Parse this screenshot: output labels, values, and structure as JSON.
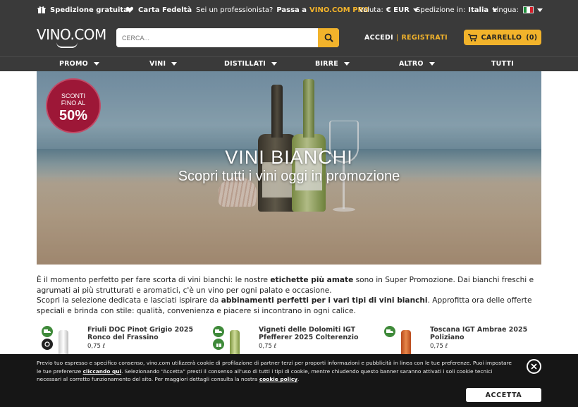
{
  "topbar": {
    "free_shipping": "Spedizione gratuita",
    "loyalty_card": "Carta Fedeltà",
    "pro_question": "Sei un professionista?",
    "pro_link_prefix": "Passa a",
    "pro_link": "VINO.COM PRO",
    "currency_label": "Valuta:",
    "currency_value": "€ EUR",
    "shipping_label": "Spedizione in:",
    "shipping_value": "Italia",
    "language_label": "Lingua:"
  },
  "header": {
    "logo": "VINO.COM",
    "search_placeholder": "CERCA...",
    "login": "ACCEDI",
    "register": "REGISTRATI",
    "cart_label": "CARRELLO",
    "cart_count": "(0)"
  },
  "nav": {
    "items": [
      {
        "label": "PROMO"
      },
      {
        "label": "VINI"
      },
      {
        "label": "DISTILLATI"
      },
      {
        "label": "BIRRE"
      },
      {
        "label": "ALTRO"
      },
      {
        "label": "TUTTI"
      }
    ]
  },
  "hero": {
    "badge_line1": "SCONTI",
    "badge_line2": "FINO AL",
    "badge_value": "50%",
    "title": "VINI BIANCHI",
    "subtitle": "Scopri tutti i vini oggi in promozione"
  },
  "description": {
    "p1_a": "È il momento perfetto per fare scorta di vini bianchi: le nostre ",
    "p1_b": "etichette più amate",
    "p1_c": " sono in Super Promozione. Dai bianchi freschi e agrumati ai più strutturati e aromatici, c'è un vino per ogni palato e occasione.",
    "p2_a": "Scopri la selezione dedicata e lasciati ispirare da ",
    "p2_b": "abbinamenti perfetti per i vari tipi di vini bianchi",
    "p2_c": ". Approfitta ora delle offerte speciali e brinda con stile: qualità, convenienza e piacere si incontrano in ogni calice."
  },
  "products": [
    {
      "name": "Friuli DOC Pinot Grigio 2025 Ronco del Frassino",
      "price": "0,75 ℓ"
    },
    {
      "name": "Vigneti delle Dolomiti IGT Pfefferer 2025 Colterenzio",
      "price": "0,75 ℓ"
    },
    {
      "name": "Toscana IGT Ambrae 2025 Poliziano",
      "price": "0,75 ℓ"
    }
  ],
  "cookie": {
    "t1": "Previo tuo espresso e specifico consenso, vino.com utilizzerà cookie di profilazione di partner terzi per proporti informazioni e pubblicità in linea con le tue preferenze. Puoi impostare le tue preferenze ",
    "link1": "cliccando qui",
    "t2": ". Selezionando “Accetta” presti il consenso all'uso di tutti i tipi di cookie, mentre chiudendo questo banner saranno attivati i soli cookie tecnici necessari al corretto funzionamento del sito. Per maggiori dettagli consulta la nostra ",
    "link2": "cookie policy",
    "t3": ".",
    "accept": "ACCETTA"
  },
  "colors": {
    "accent": "#f2b32b",
    "dark_bar": "#3a3a3a",
    "badge": "#9d1737",
    "eco_green": "#3f8a3a"
  }
}
